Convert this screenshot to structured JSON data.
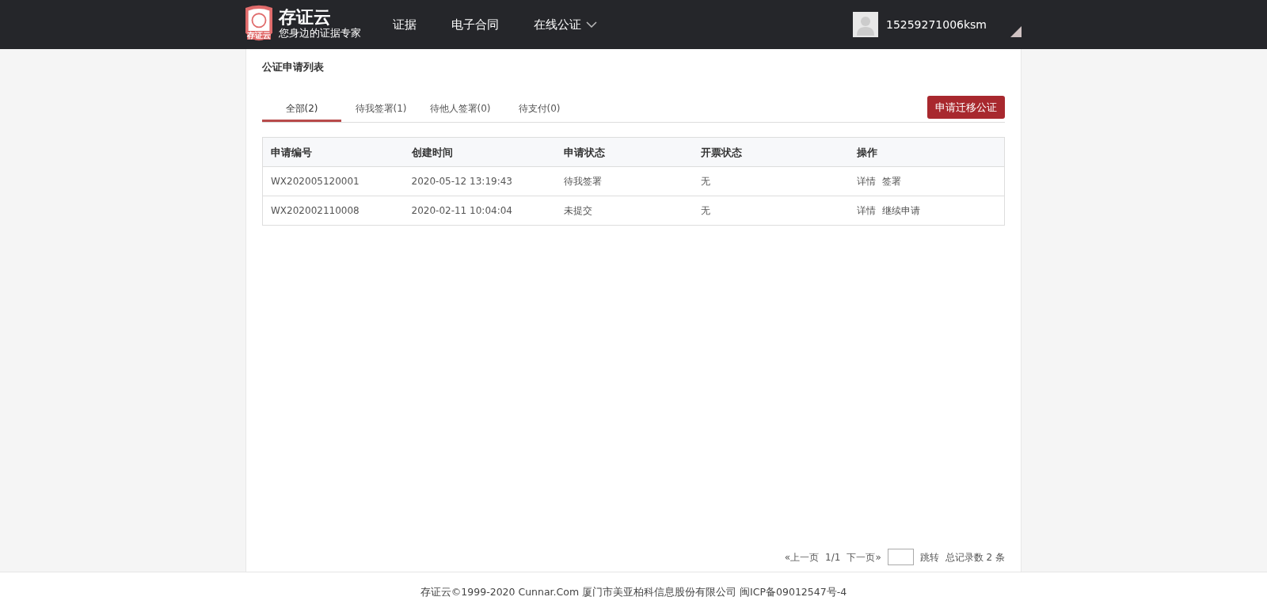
{
  "header": {
    "logo_badge": "存证云",
    "brand": "存证云",
    "slogan": "您身边的证据专家",
    "nav": [
      {
        "label": "证据",
        "dropdown": false
      },
      {
        "label": "电子合同",
        "dropdown": false
      },
      {
        "label": "在线公证",
        "dropdown": true
      }
    ],
    "user": "15259271006ksm"
  },
  "page_title": "公证申请列表",
  "tabs": [
    {
      "label": "全部(2)",
      "selected": true
    },
    {
      "label": "待我签署(1)",
      "selected": false
    },
    {
      "label": "待他人签署(0)",
      "selected": false
    },
    {
      "label": "待支付(0)",
      "selected": false
    }
  ],
  "action_button": "申请迁移公证",
  "table": {
    "columns": [
      "申请编号",
      "创建时间",
      "申请状态",
      "开票状态",
      "操作"
    ],
    "rows": [
      {
        "id": "WX202005120001",
        "created": "2020-05-12 13:19:43",
        "status": "待我签署",
        "invoice": "无",
        "actions": [
          "详情",
          "签署"
        ]
      },
      {
        "id": "WX202002110008",
        "created": "2020-02-11 10:04:04",
        "status": "未提交",
        "invoice": "无",
        "actions": [
          "详情",
          "继续申请"
        ]
      }
    ]
  },
  "pagination": {
    "prev": "«上一页",
    "page": "1/1",
    "next": "下一页»",
    "jump": "跳转",
    "total": "总记录数 2 条"
  },
  "footer": "存证云©1999-2020 Cunnar.Com 厦门市美亚柏科信息股份有限公司 闽ICP备09012547号-4"
}
